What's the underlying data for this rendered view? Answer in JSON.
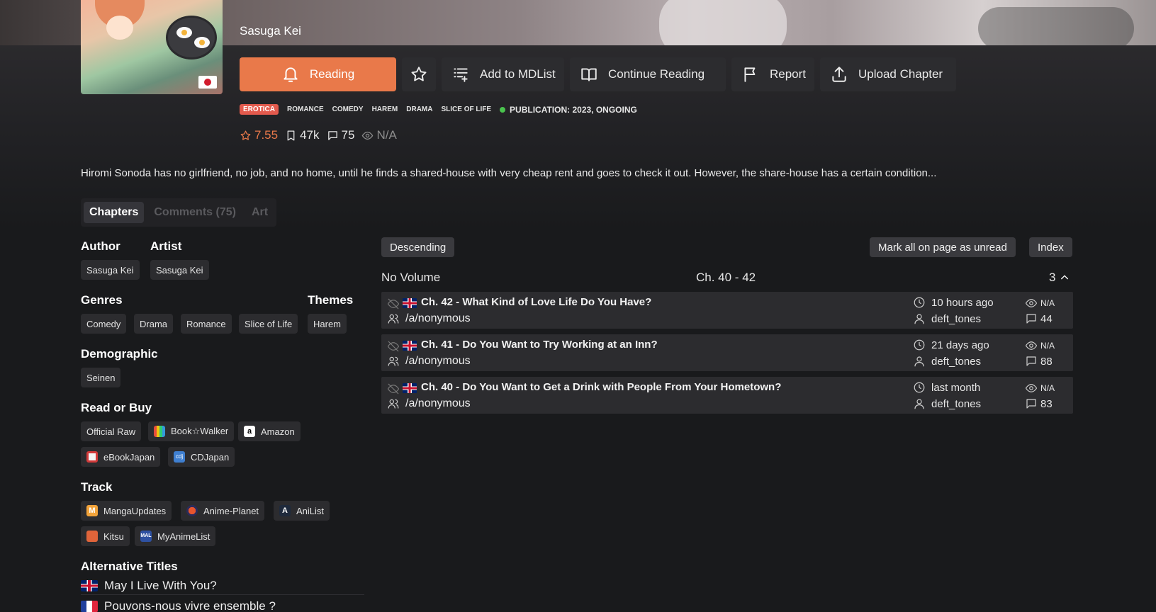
{
  "manga": {
    "author_title": "Sasuga Kei",
    "cover_flag": "jp-flag"
  },
  "actions": {
    "reading": "Reading",
    "add_list": "Add to MDList",
    "continue": "Continue Reading",
    "report": "Report",
    "upload": "Upload Chapter"
  },
  "tags": [
    "EROTICA",
    "ROMANCE",
    "COMEDY",
    "HAREM",
    "DRAMA",
    "SLICE OF LIFE"
  ],
  "publication": "PUBLICATION: 2023, ONGOING",
  "stats": {
    "rating": "7.55",
    "follows": "47k",
    "comments": "75",
    "views": "N/A"
  },
  "synopsis": "Hiromi Sonoda has no girlfriend, no job, and no home, until he finds a shared-house with very cheap rent and goes to check it out. However, the share-house has a certain condition...",
  "tabs": {
    "chapters": "Chapters",
    "comments": "Comments (75)",
    "art": "Art"
  },
  "info": {
    "author_h": "Author",
    "artist_h": "Artist",
    "author": "Sasuga Kei",
    "artist": "Sasuga Kei",
    "genres_h": "Genres",
    "themes_h": "Themes",
    "genres": [
      "Comedy",
      "Drama",
      "Romance",
      "Slice of Life"
    ],
    "themes": [
      "Harem"
    ],
    "demographic_h": "Demographic",
    "demographic": "Seinen",
    "read_h": "Read or Buy",
    "read": [
      "Official Raw",
      "Book☆Walker",
      "Amazon",
      "eBookJapan",
      "CDJapan"
    ],
    "track_h": "Track",
    "track": [
      "MangaUpdates",
      "Anime-Planet",
      "AniList",
      "Kitsu",
      "MyAnimeList"
    ],
    "alt_h": "Alternative Titles",
    "alt": [
      "May I Live With You?",
      "Pouvons-nous vivre ensemble ?"
    ]
  },
  "chapter_controls": {
    "order": "Descending",
    "mark": "Mark all on page as unread",
    "index": "Index"
  },
  "volume": {
    "name": "No Volume",
    "range": "Ch. 40 - 42",
    "count": "3"
  },
  "chapters": [
    {
      "title": "Ch. 42 - What Kind of Love Life Do You Have?",
      "group": "/a/nonymous",
      "time": "10 hours ago",
      "uploader": "deft_tones",
      "views": "N/A",
      "comments": "44"
    },
    {
      "title": "Ch. 41 - Do You Want to Try Working at an Inn?",
      "group": "/a/nonymous",
      "time": "21 days ago",
      "uploader": "deft_tones",
      "views": "N/A",
      "comments": "88"
    },
    {
      "title": "Ch. 40 - Do You Want to Get a Drink with People From Your Hometown?",
      "group": "/a/nonymous",
      "time": "last month",
      "uploader": "deft_tones",
      "views": "N/A",
      "comments": "83"
    }
  ],
  "colors": {
    "accent": "#e9794a",
    "erotica": "#e35a4d",
    "ongoing": "#4ac34e",
    "background": "#191a1c",
    "surface": "#2c2c2f"
  }
}
